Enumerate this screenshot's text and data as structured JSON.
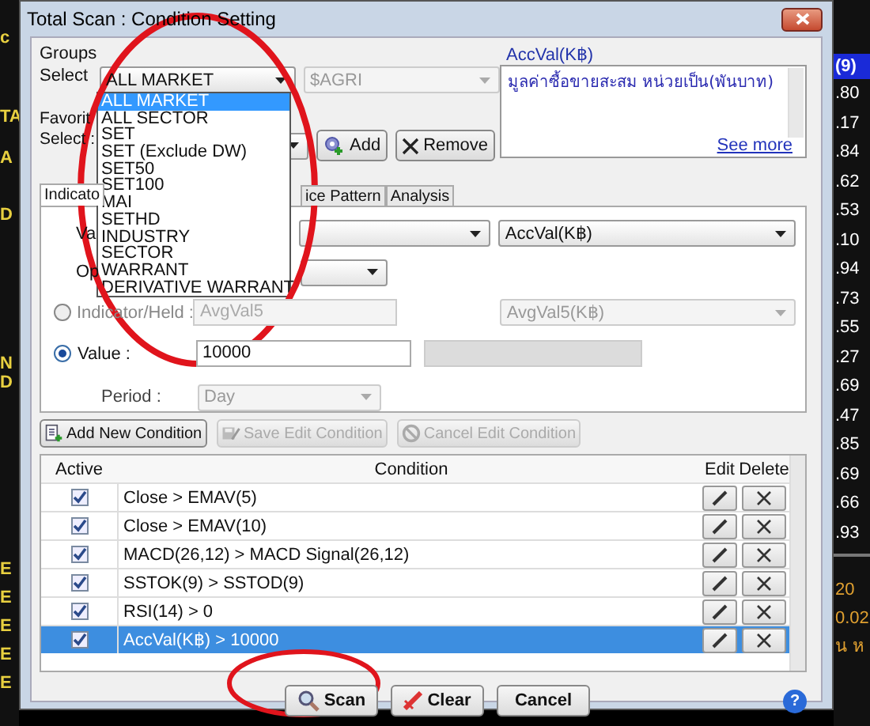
{
  "background": {
    "left_column": [
      "c",
      "TA",
      "A",
      "D",
      "N",
      "D",
      "E",
      "E",
      "E",
      "E",
      "E"
    ],
    "right_header": "(9)",
    "right_column": [
      ".80",
      ".17",
      ".84",
      ".62",
      ".53",
      ".10",
      ".94",
      ".73",
      ".55",
      ".27",
      ".69",
      ".47",
      ".85",
      ".69",
      ".66",
      ".93"
    ],
    "right_lower": [
      "20",
      "0.02",
      "น ห"
    ]
  },
  "window": {
    "title": "Total Scan : Condition Setting"
  },
  "groups": {
    "label": "Groups",
    "select_label": "Select",
    "value": "ALL MARKET",
    "symbol": "$AGRI"
  },
  "dropdown": {
    "items": [
      {
        "label": "ALL MARKET",
        "selected": true
      },
      {
        "label": "ALL SECTOR",
        "selected": false
      },
      {
        "label": "SET",
        "selected": false
      },
      {
        "label": "SET (Exclude DW)",
        "selected": false
      },
      {
        "label": "SET50",
        "selected": false
      },
      {
        "label": "SET100",
        "selected": false
      },
      {
        "label": "MAI",
        "selected": false
      },
      {
        "label": "SETHD",
        "selected": false
      },
      {
        "label": "INDUSTRY",
        "selected": false
      },
      {
        "label": "SECTOR",
        "selected": false
      },
      {
        "label": "WARRANT",
        "selected": false
      },
      {
        "label": "DERIVATIVE WARRANT",
        "selected": false
      }
    ]
  },
  "description": {
    "title": "AccVal(K฿)",
    "text": "มูลค่าซื้อขายสะสม หน่วยเป็น(พันบาท)",
    "link": "See more"
  },
  "favorites": {
    "label": "Favorit",
    "select_label": "Select :",
    "add": "Add",
    "remove": "Remove"
  },
  "tabs": [
    {
      "label": "Indicato",
      "selected": true
    },
    {
      "label": "ice Pattern",
      "selected": false
    },
    {
      "label": "Analysis",
      "selected": false
    }
  ],
  "form": {
    "value_label": "Va",
    "value_combo": "AccVal(K฿)",
    "operator_label": "Op",
    "radios": [
      {
        "label": "Indicator/Held :",
        "selected": false,
        "field": "AvgVal5",
        "field2": "AvgVal5(K฿)"
      },
      {
        "label": "Value :",
        "selected": true,
        "field": "10000"
      }
    ],
    "period_label": "Period :",
    "period": "Day"
  },
  "actions": [
    {
      "label": "Add New Condition",
      "disabled": false
    },
    {
      "label": "Save Edit Condition",
      "disabled": true
    },
    {
      "label": "Cancel Edit Condition",
      "disabled": true
    }
  ],
  "table": {
    "columns": [
      "Active",
      "Condition",
      "Edit",
      "Delete"
    ],
    "rows": [
      {
        "active": true,
        "condition": "Close > EMAV(5)",
        "selected": false
      },
      {
        "active": true,
        "condition": "Close > EMAV(10)",
        "selected": false
      },
      {
        "active": true,
        "condition": "MACD(26,12) > MACD Signal(26,12)",
        "selected": false
      },
      {
        "active": true,
        "condition": "SSTOK(9) > SSTOD(9)",
        "selected": false
      },
      {
        "active": true,
        "condition": "RSI(14) > 0",
        "selected": false
      },
      {
        "active": true,
        "condition": "AccVal(K฿) > 10000",
        "selected": true
      }
    ]
  },
  "footer": {
    "scan": "Scan",
    "clear": "Clear",
    "cancel": "Cancel",
    "help": "?"
  }
}
